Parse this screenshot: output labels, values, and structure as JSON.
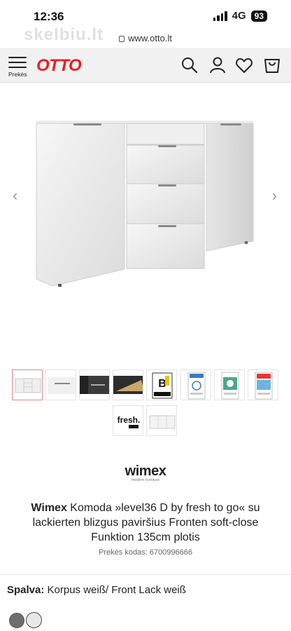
{
  "status_bar": {
    "time": "12:36",
    "network": "4G",
    "battery": "93"
  },
  "browser": {
    "url": "www.otto.lt",
    "watermark": "skelbiu.lt"
  },
  "header": {
    "menu_label": "Prekės",
    "logo": "OTTO",
    "icons": [
      "search-icon",
      "user-icon",
      "heart-icon",
      "cart-icon"
    ]
  },
  "gallery": {
    "prev": "‹",
    "next": "›"
  },
  "thumbnails": [
    {
      "kind": "sideboard-front",
      "active": true
    },
    {
      "kind": "handle-detail"
    },
    {
      "kind": "dark-detail"
    },
    {
      "kind": "drawer-open"
    },
    {
      "kind": "quality-badge",
      "text": "Möbelbranche Qualität"
    },
    {
      "kind": "dgm-seal",
      "text": "DGM"
    },
    {
      "kind": "certificate-green"
    },
    {
      "kind": "ral-seal",
      "text": "RAL"
    },
    {
      "kind": "fresh-logo",
      "text": "fresh. to go"
    },
    {
      "kind": "sideboard-dimensions"
    }
  ],
  "brand": {
    "name": "wimex",
    "tagline": "modern furniture"
  },
  "product": {
    "brand": "Wimex",
    "title": " Komoda »level36 D by fresh to go« su lackierten blizgus paviršius Fronten soft-close Funktion 135cm plotis",
    "code": "Prekės kodas: 6700996666"
  },
  "color": {
    "label": "Spalva:",
    "value": " Korpus weiß/ Front Lack weiß",
    "swatches": [
      {
        "name": "grey",
        "hex": "#6e6e6e",
        "selected": false
      },
      {
        "name": "white",
        "hex": "#e8e8e8",
        "selected": true
      }
    ]
  },
  "colors": {
    "brand_red": "#f11a1e",
    "header_bg": "#f1f1f1"
  }
}
